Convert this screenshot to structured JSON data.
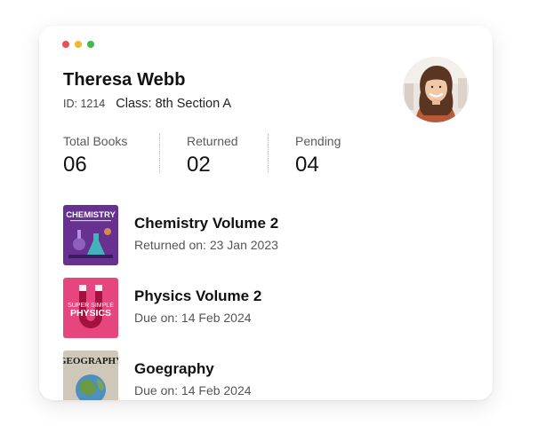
{
  "window_controls": {
    "close_color": "#ed4f4f",
    "minimize_color": "#f5b52e",
    "maximize_color": "#3dbb4b"
  },
  "student": {
    "name": "Theresa Webb",
    "id_label": "ID: 1214",
    "class_label": "Class: 8th Section A"
  },
  "stats": [
    {
      "label": "Total Books",
      "value": "06"
    },
    {
      "label": "Returned",
      "value": "02"
    },
    {
      "label": "Pending",
      "value": "04"
    }
  ],
  "books": [
    {
      "title": "Chemistry Volume 2",
      "status": "Returned on: 23 Jan 2023",
      "cover_text": "CHEMISTRY",
      "cover_color": "#5b2d86"
    },
    {
      "title": "Physics Volume 2",
      "status": "Due on: 14 Feb 2024",
      "cover_text_top": "SUPER SIMPLE",
      "cover_text": "PHYSICS",
      "cover_color": "#e6457d"
    },
    {
      "title": "Goegraphy",
      "status": "Due on: 14 Feb 2024",
      "cover_text": "GEOGRAPHY",
      "cover_color": "#cfc7b8"
    }
  ]
}
